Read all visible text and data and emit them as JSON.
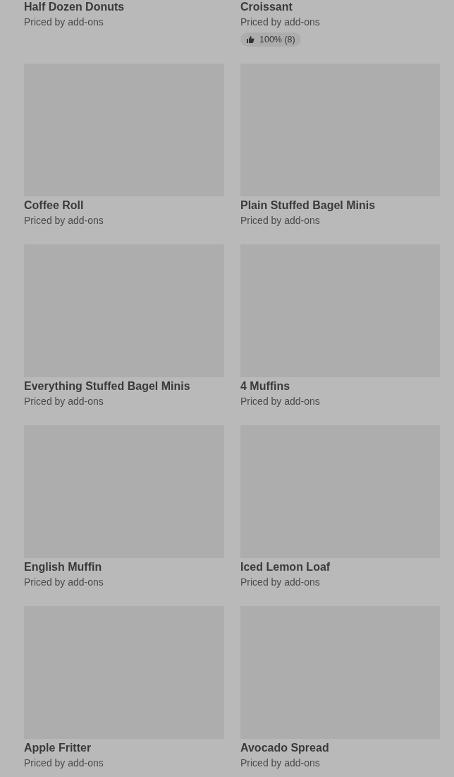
{
  "items": [
    {
      "title": "Half Dozen Donuts",
      "subtitle": "Priced by add-ons"
    },
    {
      "title": "Croissant",
      "subtitle": "Priced by add-ons",
      "rating": "100% (8)"
    },
    {
      "kind": "picture",
      "title": "Coffee Roll",
      "subtitle": "Priced by add-ons"
    },
    {
      "kind": "picture",
      "title": "Plain Stuffed Bagel Minis",
      "subtitle": "Priced by add-ons"
    },
    {
      "kind": "picture",
      "title": "Everything Stuffed Bagel Minis",
      "subtitle": "Priced by add-ons"
    },
    {
      "kind": "picture",
      "title": "4 Muffins",
      "subtitle": "Priced by add-ons"
    },
    {
      "kind": "picture",
      "title": "English Muffin",
      "subtitle": "Priced by add-ons"
    },
    {
      "kind": "picture",
      "title": "Iced Lemon Loaf",
      "subtitle": "Priced by add-ons"
    },
    {
      "kind": "picture",
      "title": "Apple Fritter",
      "subtitle": "Priced by add-ons"
    },
    {
      "kind": "picture",
      "title": "Avocado Spread",
      "subtitle": "Priced by add-ons"
    }
  ]
}
